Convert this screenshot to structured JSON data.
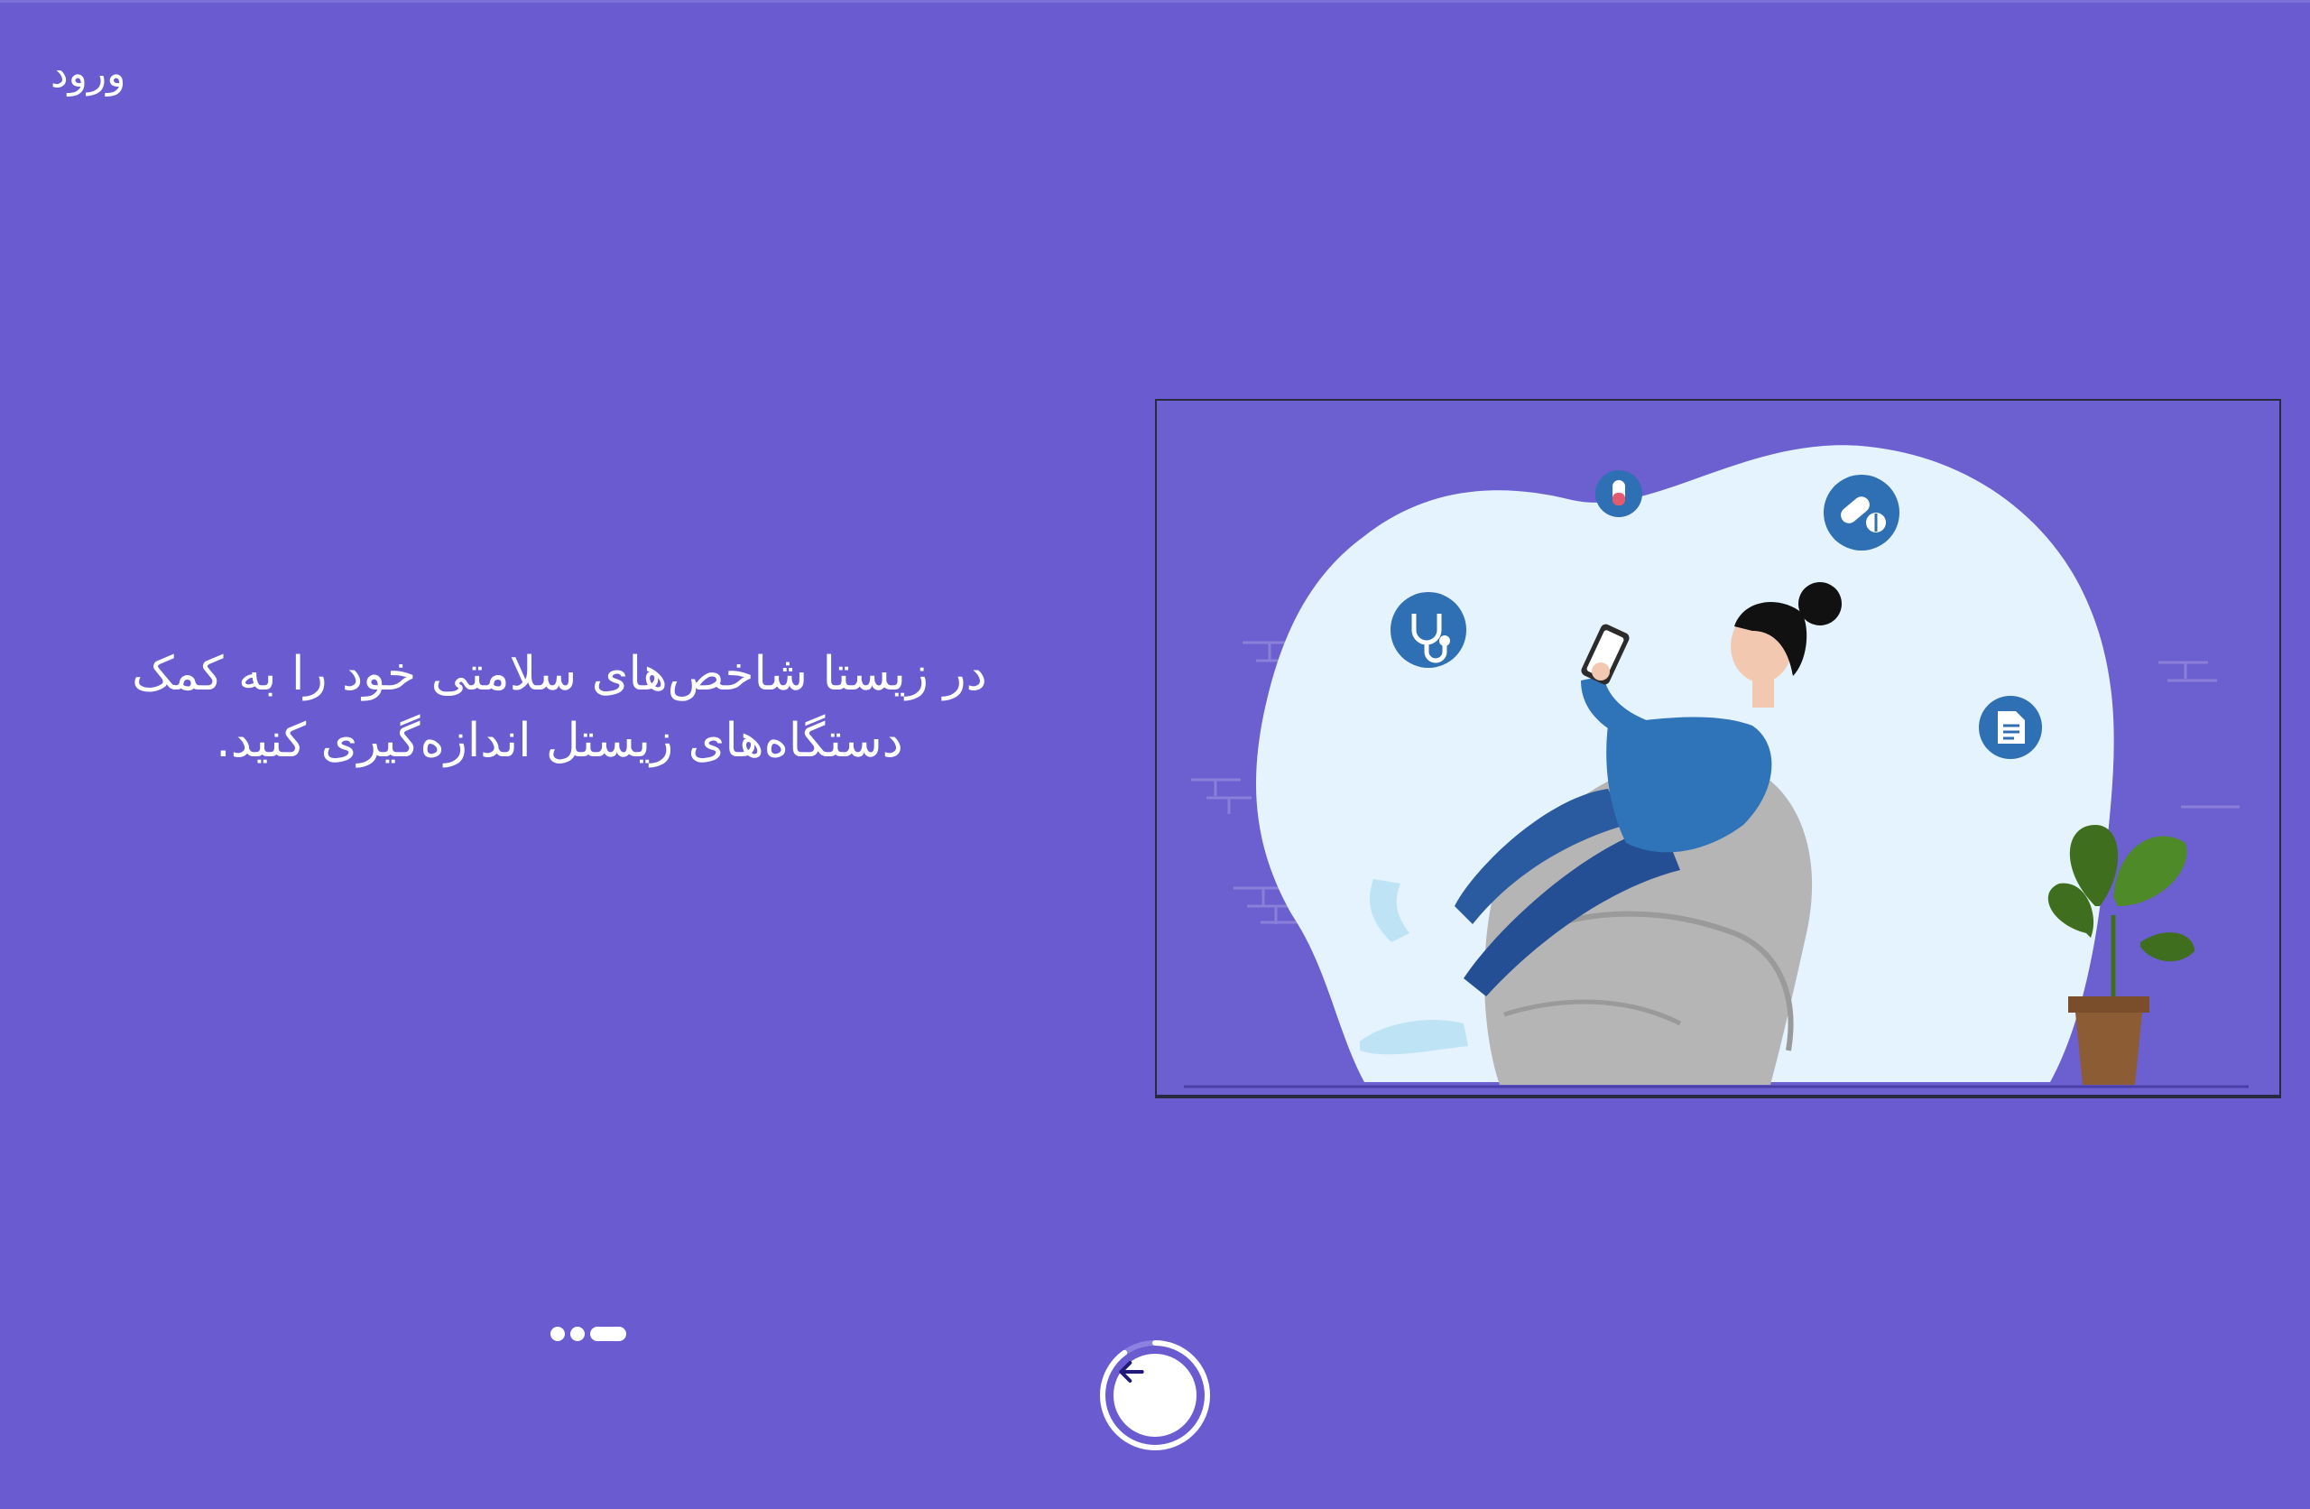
{
  "header": {
    "login_label": "ورود"
  },
  "onboarding": {
    "description_line1": "در زیستا شاخص‌های سلامتی خود را به کمک",
    "description_line2": "دستگاه‌های زیستل اندازه‌گیری کنید.",
    "illustration": {
      "subject": "woman-on-beanbag-with-phone",
      "floating_icons": [
        "test-tube-icon",
        "pill-icon",
        "stethoscope-icon",
        "document-icon"
      ]
    },
    "pagination": {
      "total": 3,
      "active_index": 2
    },
    "next_button": {
      "icon": "arrow-left-icon",
      "progress": 0.9
    }
  },
  "colors": {
    "background": "#6a5cd0",
    "illustration_bg": "#6c5fcf",
    "blob": "#e4f3fd",
    "icon_badge": "#2f6fb3",
    "text": "#ffffff",
    "arrow": "#1f1a7a"
  }
}
